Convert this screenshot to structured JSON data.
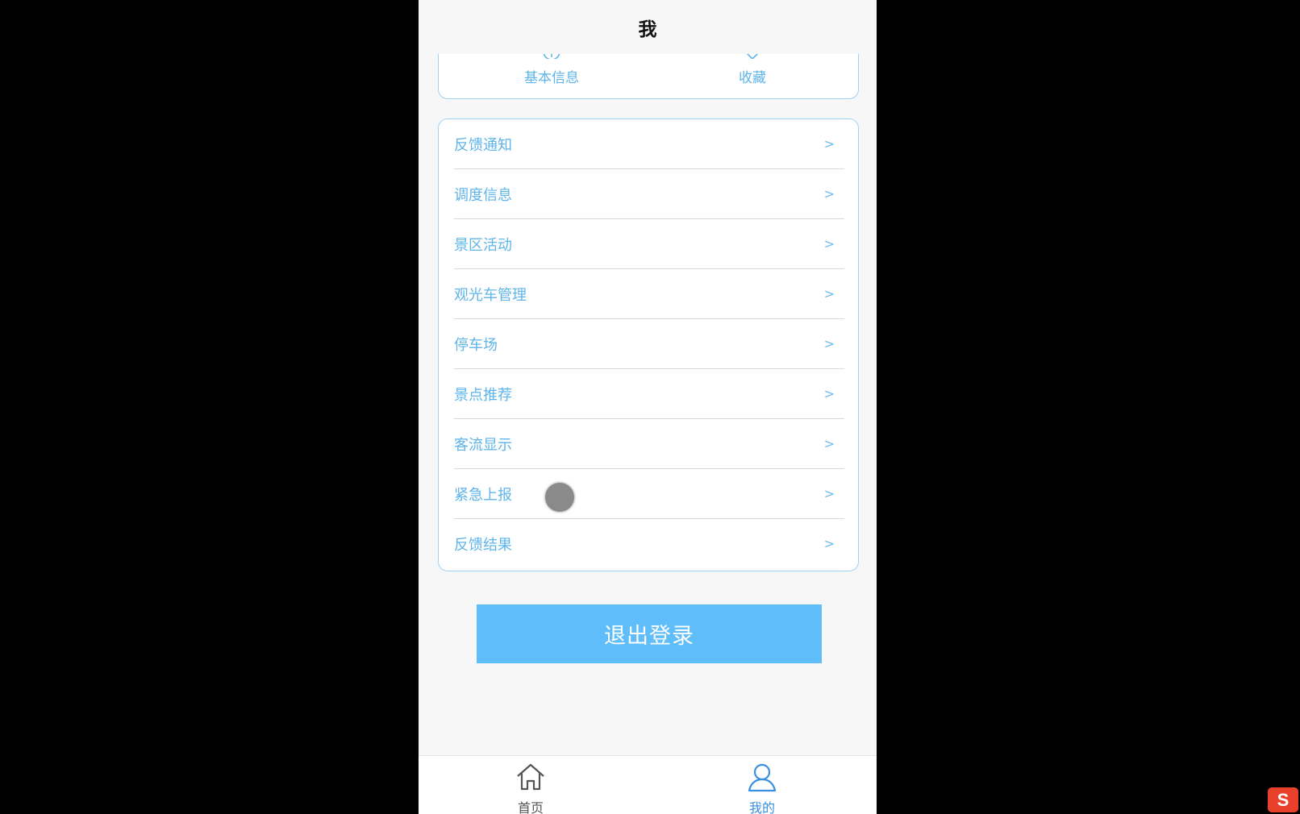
{
  "header": {
    "title": "我"
  },
  "quick_links": [
    {
      "label": "基本信息",
      "icon": "info-icon"
    },
    {
      "label": "收藏",
      "icon": "favorite-icon"
    }
  ],
  "menu": [
    {
      "label": "反馈通知",
      "arrow": ">"
    },
    {
      "label": "调度信息",
      "arrow": ">"
    },
    {
      "label": "景区活动",
      "arrow": ">"
    },
    {
      "label": "观光车管理",
      "arrow": ">"
    },
    {
      "label": "停车场",
      "arrow": ">"
    },
    {
      "label": "景点推荐",
      "arrow": ">"
    },
    {
      "label": "客流显示",
      "arrow": ">"
    },
    {
      "label": "紧急上报",
      "arrow": ">"
    },
    {
      "label": "反馈结果",
      "arrow": ">"
    }
  ],
  "logout_label": "退出登录",
  "tabbar": [
    {
      "label": "首页",
      "icon": "home-icon",
      "active": false
    },
    {
      "label": "我的",
      "icon": "user-icon",
      "active": true
    }
  ],
  "ime_indicator": "S",
  "colors": {
    "accent": "#5fb4ea",
    "button": "#5fbdfa",
    "tab_inactive": "#555555",
    "tab_active": "#3a8fe0"
  }
}
